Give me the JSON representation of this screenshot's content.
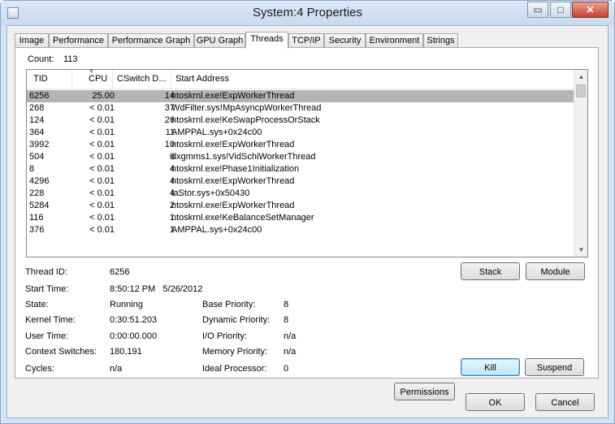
{
  "window": {
    "title": "System:4 Properties",
    "buttons": {
      "minimize": "▭",
      "maximize": "□",
      "close": "✕"
    }
  },
  "tabs": [
    {
      "label": "Image"
    },
    {
      "label": "Performance"
    },
    {
      "label": "Performance Graph"
    },
    {
      "label": "GPU Graph"
    },
    {
      "label": "Threads"
    },
    {
      "label": "TCP/IP"
    },
    {
      "label": "Security"
    },
    {
      "label": "Environment"
    },
    {
      "label": "Strings"
    }
  ],
  "active_tab": "Threads",
  "count": {
    "label": "Count:",
    "value": "113"
  },
  "table": {
    "columns": [
      "TID",
      "CPU",
      "CSwitch D...",
      "Start Address"
    ],
    "sort_column": "CPU",
    "selected_row": 0,
    "rows": [
      [
        "6256",
        "25.00",
        "14",
        "ntoskrnl.exe!ExpWorkerThread"
      ],
      [
        "268",
        "< 0.01",
        "37",
        "WdFilter.sys!MpAsyncpWorkerThread"
      ],
      [
        "124",
        "< 0.01",
        "26",
        "ntoskrnl.exe!KeSwapProcessOrStack"
      ],
      [
        "364",
        "< 0.01",
        "11",
        "AMPPAL.sys+0x24c00"
      ],
      [
        "3992",
        "< 0.01",
        "10",
        "ntoskrnl.exe!ExpWorkerThread"
      ],
      [
        "504",
        "< 0.01",
        "6",
        "dxgmms1.sys!VidSchiWorkerThread"
      ],
      [
        "8",
        "< 0.01",
        "4",
        "ntoskrnl.exe!Phase1Initialization"
      ],
      [
        "4296",
        "< 0.01",
        "4",
        "ntoskrnl.exe!ExpWorkerThread"
      ],
      [
        "228",
        "< 0.01",
        "4",
        "iaStor.sys+0x50430"
      ],
      [
        "5284",
        "< 0.01",
        "2",
        "ntoskrnl.exe!ExpWorkerThread"
      ],
      [
        "116",
        "< 0.01",
        "1",
        "ntoskrnl.exe!KeBalanceSetManager"
      ],
      [
        "376",
        "< 0.01",
        "1",
        "AMPPAL.sys+0x24c00"
      ]
    ]
  },
  "details": {
    "thread_id": {
      "label": "Thread ID:",
      "value": "6256"
    },
    "start_time": {
      "label": "Start Time:",
      "value": "8:50:12 PM   5/26/2012"
    },
    "state": {
      "label": "State:",
      "value": "Running"
    },
    "kernel_time": {
      "label": "Kernel Time:",
      "value": "0:30:51.203"
    },
    "user_time": {
      "label": "User Time:",
      "value": "0:00:00.000"
    },
    "context_switches": {
      "label": "Context Switches:",
      "value": "180,191"
    },
    "cycles": {
      "label": "Cycles:",
      "value": "n/a"
    },
    "base_priority": {
      "label": "Base Priority:",
      "value": "8"
    },
    "dynamic_priority": {
      "label": "Dynamic Priority:",
      "value": "8"
    },
    "io_priority": {
      "label": "I/O Priority:",
      "value": "n/a"
    },
    "memory_priority": {
      "label": "Memory Priority:",
      "value": "n/a"
    },
    "ideal_processor": {
      "label": "Ideal Processor:",
      "value": "0"
    }
  },
  "buttons": {
    "stack": "Stack",
    "module": "Module",
    "permissions": "Permissions",
    "kill": "Kill",
    "suspend": "Suspend",
    "ok": "OK",
    "cancel": "Cancel"
  },
  "icons": {
    "app": "window-app-icon",
    "scroll_up": "chevron-up-icon",
    "scroll_down": "chevron-down-icon",
    "sort": "sort-desc-icon"
  },
  "colors": {
    "selected_row": "#b4b4b4",
    "frame": "#d4e3f5",
    "close_button": "#c7402c"
  }
}
